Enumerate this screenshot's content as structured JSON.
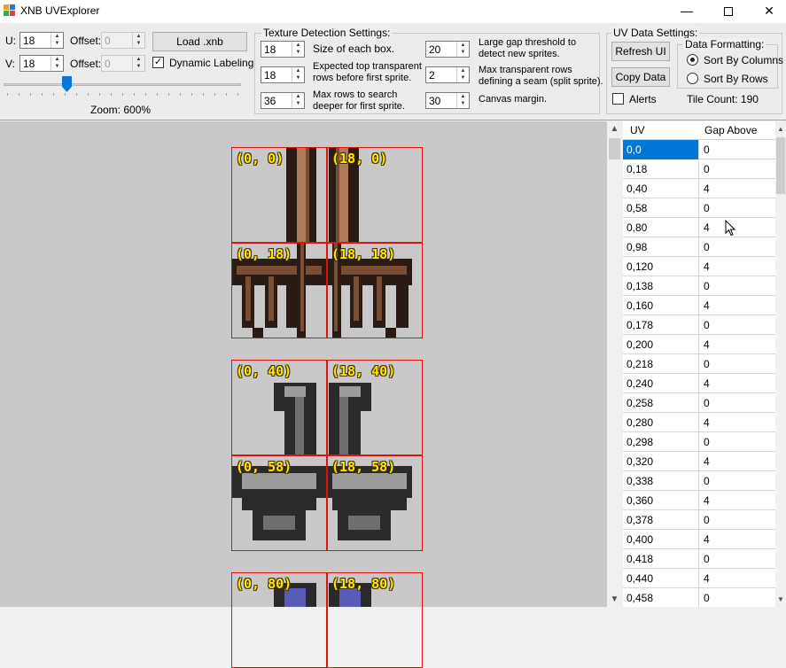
{
  "window": {
    "title": "XNB UVExplorer",
    "min_glyph": "—",
    "close_glyph": "✕"
  },
  "left_controls": {
    "u_label": "U:",
    "u_value": "18",
    "v_label": "V:",
    "v_value": "18",
    "offset_label": "Offset:",
    "u_offset": "0",
    "v_offset": "0",
    "load_button": "Load .xnb",
    "dynamic_labeling_label": "Dynamic Labeling",
    "dynamic_labeling_checked": true,
    "zoom_label": "Zoom: 600%",
    "zoom_percent": 600
  },
  "detection": {
    "title": "Texture Detection Settings:",
    "box_size": "18",
    "box_size_label": "Size of each box.",
    "top_transparent": "18",
    "top_transparent_label_1": "Expected top transparent",
    "top_transparent_label_2": "rows before first sprite.",
    "max_rows": "36",
    "max_rows_label_1": "Max rows to search",
    "max_rows_label_2": "deeper for first sprite.",
    "gap_threshold": "20",
    "gap_threshold_label_1": "Large gap threshold to",
    "gap_threshold_label_2": "detect new sprites.",
    "seam_rows": "2",
    "seam_rows_label_1": "Max transparent rows",
    "seam_rows_label_2": "defining a seam (split sprite).",
    "canvas_margin": "30",
    "canvas_margin_label": "Canvas margin."
  },
  "uv_settings": {
    "title": "UV Data Settings:",
    "refresh_button": "Refresh UI",
    "copy_button": "Copy Data",
    "alerts_label": "Alerts",
    "alerts_checked": false,
    "formatting_title": "Data Formatting:",
    "sort_columns_label": "Sort By Columns",
    "sort_rows_label": "Sort By Rows",
    "sort_mode": "columns",
    "tile_count": "Tile Count: 190"
  },
  "canvas": {
    "labels": [
      "(0, 0)",
      "(18, 0)",
      "(0, 18)",
      "(18, 18)",
      "(0, 40)",
      "(18, 40)",
      "(0, 58)",
      "(18, 58)",
      "(0, 80)",
      "(18, 80)"
    ]
  },
  "table": {
    "headers": [
      "UV",
      "Gap Above"
    ],
    "rows": [
      [
        "0,0",
        "0"
      ],
      [
        "0,18",
        "0"
      ],
      [
        "0,40",
        "4"
      ],
      [
        "0,58",
        "0"
      ],
      [
        "0,80",
        "4"
      ],
      [
        "0,98",
        "0"
      ],
      [
        "0,120",
        "4"
      ],
      [
        "0,138",
        "0"
      ],
      [
        "0,160",
        "4"
      ],
      [
        "0,178",
        "0"
      ],
      [
        "0,200",
        "4"
      ],
      [
        "0,218",
        "0"
      ],
      [
        "0,240",
        "4"
      ],
      [
        "0,258",
        "0"
      ],
      [
        "0,280",
        "4"
      ],
      [
        "0,298",
        "0"
      ],
      [
        "0,320",
        "4"
      ],
      [
        "0,338",
        "0"
      ],
      [
        "0,360",
        "4"
      ],
      [
        "0,378",
        "0"
      ],
      [
        "0,400",
        "4"
      ],
      [
        "0,418",
        "0"
      ],
      [
        "0,440",
        "4"
      ],
      [
        "0,458",
        "0"
      ]
    ],
    "selected_row": 0
  },
  "icons": {
    "app": "app-icon",
    "minimize": "minimize-icon",
    "maximize": "maximize-icon",
    "close": "close-icon",
    "cursor": "mouse-cursor-icon"
  },
  "colors": {
    "accent": "#0078d7",
    "slider_thumb": "#0a74da",
    "grid_line": "#e01010",
    "label_yellow": "#ffe600",
    "canvas_bg": "#c8c8c8",
    "brown_dark": "#2a1b14",
    "brown_mid": "#7a4e34",
    "brown_light": "#b07a58",
    "gray_dark": "#2a2a2a",
    "gray_mid": "#6e6e6e",
    "gray_light": "#9c9c9c",
    "purple": "#5a5ab8"
  }
}
